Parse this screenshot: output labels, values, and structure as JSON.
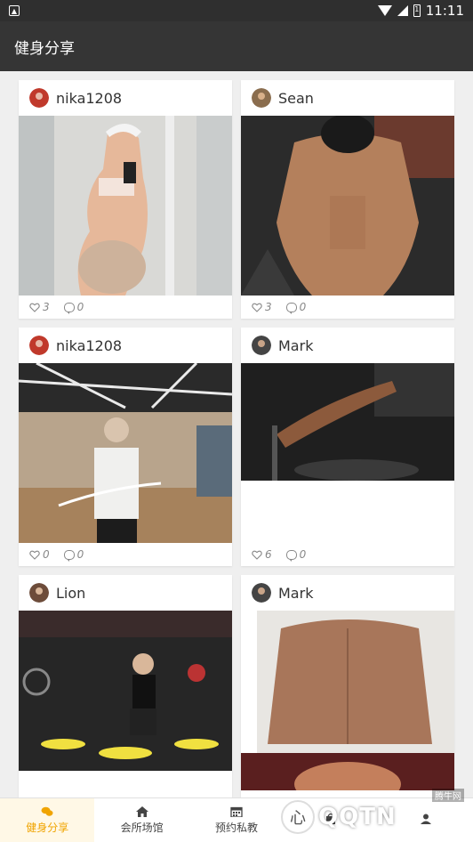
{
  "status_bar": {
    "time": "11:11",
    "battery_label": "1"
  },
  "app_bar": {
    "title": "健身分享"
  },
  "posts": [
    {
      "user": "nika1208",
      "likes": "3",
      "comments": "0"
    },
    {
      "user": "Sean",
      "likes": "3",
      "comments": "0"
    },
    {
      "user": "nika1208",
      "likes": "0",
      "comments": "0"
    },
    {
      "user": "Mark",
      "likes": "6",
      "comments": "0"
    },
    {
      "user": "Lion"
    },
    {
      "user": "Mark"
    }
  ],
  "tabs": [
    {
      "label": "健身分享",
      "icon": "chat-bubbles-icon",
      "active": true
    },
    {
      "label": "会所场馆",
      "icon": "home-icon",
      "active": false
    },
    {
      "label": "预约私教",
      "icon": "calendar-icon",
      "active": false
    },
    {
      "label": "",
      "icon": "shop-icon",
      "active": false
    },
    {
      "label": "",
      "icon": "person-icon",
      "active": false
    }
  ],
  "watermark": {
    "text": "QQTN",
    "small": "腾牛网",
    "circle": "心"
  },
  "colors": {
    "accent": "#f0a400",
    "appbar": "#353535",
    "statusbar": "#2f2f2f",
    "background": "#efefef"
  }
}
